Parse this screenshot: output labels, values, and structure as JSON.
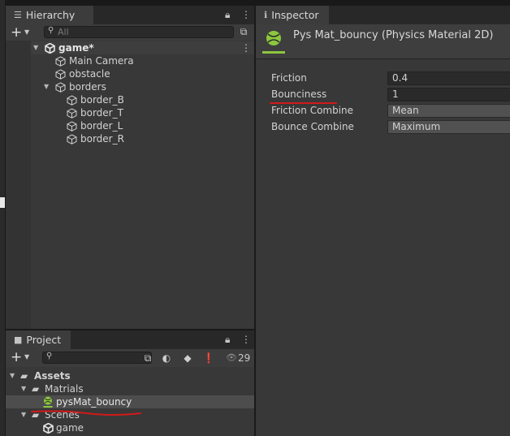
{
  "hierarchy": {
    "tab_label": "Hierarchy",
    "search_placeholder": "All",
    "scene": "game*",
    "items": [
      {
        "label": "Main Camera"
      },
      {
        "label": "obstacle"
      },
      {
        "label": "borders"
      },
      {
        "label": "border_B"
      },
      {
        "label": "border_T"
      },
      {
        "label": "border_L"
      },
      {
        "label": "border_R"
      }
    ]
  },
  "project": {
    "tab_label": "Project",
    "hidden_count": "29",
    "tree": [
      {
        "label": "Assets"
      },
      {
        "label": "Matrials"
      },
      {
        "label": "pysMat_bouncy"
      },
      {
        "label": "Scenes"
      },
      {
        "label": "game"
      }
    ]
  },
  "inspector": {
    "tab_label": "Inspector",
    "asset_title": "Pys Mat_bouncy (Physics Material 2D)",
    "properties": [
      {
        "label": "Friction",
        "value": "0.4"
      },
      {
        "label": "Bounciness",
        "value": "1"
      },
      {
        "label": "Friction Combine",
        "value": "Mean"
      },
      {
        "label": "Bounce Combine",
        "value": "Maximum"
      }
    ]
  },
  "colors": {
    "physics_material_icon": "#8dc63f",
    "annotation_red": "#d11a1a",
    "panel_bg": "#383838",
    "selection_bg": "#4d4d4d"
  }
}
